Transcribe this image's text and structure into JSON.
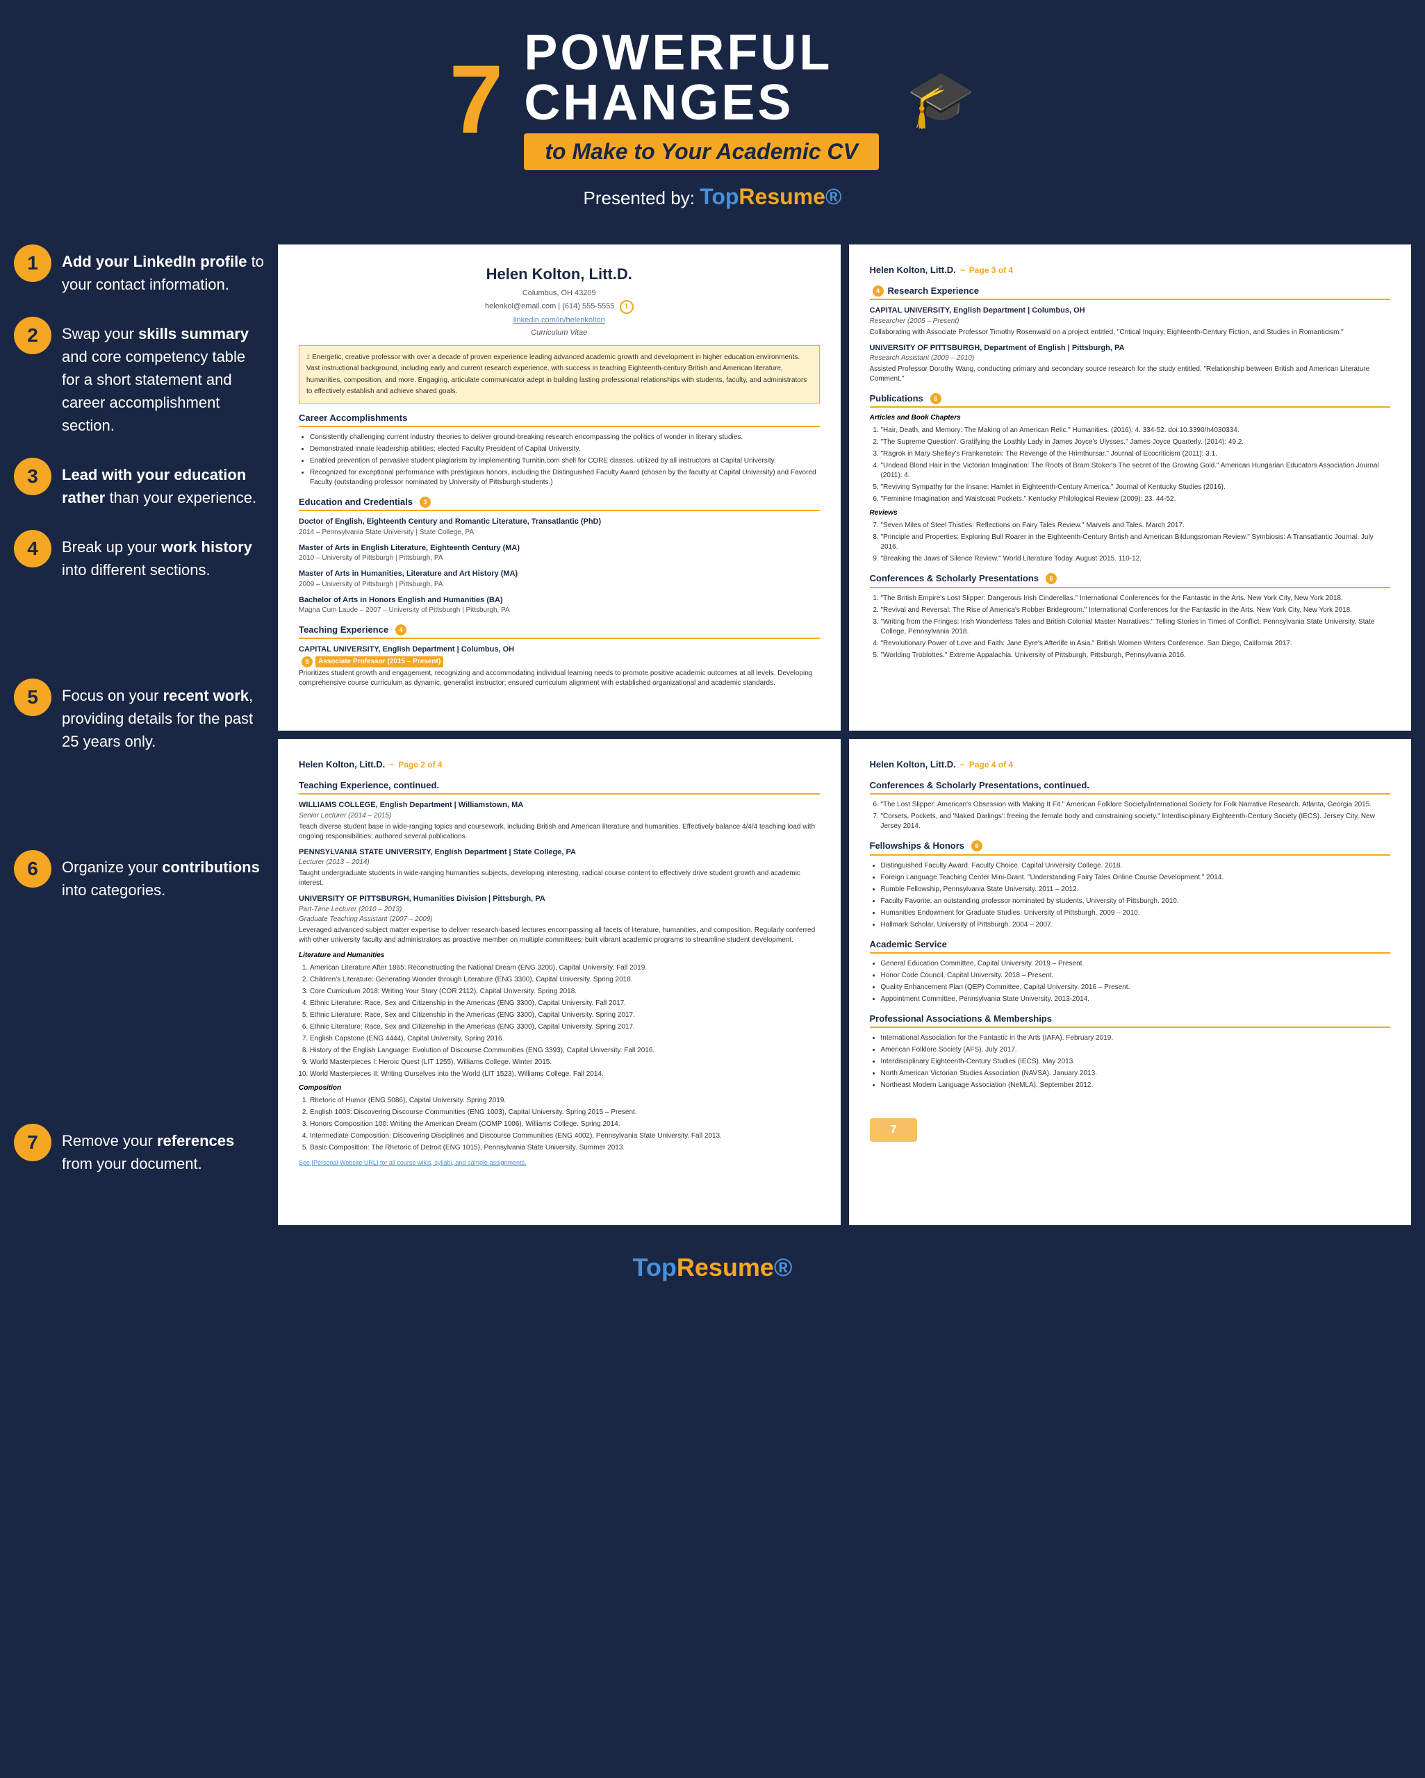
{
  "header": {
    "number": "7",
    "powerful": "POWERFUL",
    "changes": "CHANGES",
    "subtitle": "to Make to Your Academic CV",
    "presented_by": "Presented by:",
    "logo_top": "Top",
    "logo_bottom": "Resume"
  },
  "tips": [
    {
      "number": "1",
      "text_parts": [
        "Add your ",
        "LinkedIn profile",
        " to your contact information."
      ]
    },
    {
      "number": "2",
      "text_parts": [
        "Swap your ",
        "skills summary",
        " and core competency table for a short statement and career accomplishment section."
      ]
    },
    {
      "number": "3",
      "text_parts": [
        "Lead with your ",
        "education rather",
        " than your experience."
      ]
    },
    {
      "number": "4",
      "text_parts": [
        "Break up your ",
        "work history",
        " into different sections."
      ]
    },
    {
      "number": "5",
      "text_parts": [
        "Focus on your ",
        "recent work",
        ", providing details for the past 25 years only."
      ]
    },
    {
      "number": "6",
      "text_parts": [
        "Organize your ",
        "contributions",
        " into categories."
      ]
    },
    {
      "number": "7",
      "text_parts": [
        "Remove your ",
        "references",
        " from your document."
      ]
    }
  ],
  "page1": {
    "name": "Helen Kolton, Litt.D.",
    "location": "Columbus, OH 43209",
    "email": "helenkol@email.com",
    "phone": "(614) 555-5555",
    "linkedin": "linkedin.com/in/helenkolton",
    "vitae": "Curriculum Vitae",
    "summary": "Energetic, creative professor with over a decade of proven experience leading advanced academic growth and development in higher education environments. Vast instructional background, including early and current research experience, with success in teaching Eighteenth-century British and American literature, humanities, composition, and more. Engaging, articulate communicator adept in building lasting professional relationships with students, faculty, and administrators to effectively establish and achieve shared goals.",
    "section_career": "Career Accomplishments",
    "career_items": [
      "Consistently challenging current industry theories to deliver ground-breaking research encompassing the politics of wonder in literary studies.",
      "Demonstrated innate leadership abilities; elected Faculty President of Capital University.",
      "Enabled prevention of pervasive student plagiarism by implementing Turnitin.com shell for CORE classes, utilized by all instructors at Capital University.",
      "Recognized for exceptional performance with prestigious honors, including the Distinguished Faculty Award (chosen by the faculty at Capital University) and Favored Faculty (outstanding professor nominated by University of Pittsburgh students.)"
    ],
    "section_education": "Education and Credentials",
    "education_badge": "3",
    "education_items": [
      {
        "degree": "Doctor of English, Eighteenth Century and Romantic Literature, Transatlantic (PhD)",
        "detail": "2014 – Pennsylvania State University | State College, PA"
      },
      {
        "degree": "Master of Arts in English Literature, Eighteenth Century (MA)",
        "detail": "2010 – University of Pittsburgh | Pittsburgh, PA"
      },
      {
        "degree": "Master of Arts in Humanities, Literature and Art History (MA)",
        "detail": "2009 – University of Pittsburgh | Pittsburgh, PA"
      },
      {
        "degree": "Bachelor of Arts in Honors English and Humanities (BA)",
        "detail": "Magna Cum Laude – 2007 – University of Pittsburgh | Pittsburgh, PA"
      }
    ],
    "section_teaching": "Teaching Experience",
    "teaching_badge": "4",
    "teaching_place": "CAPITAL UNIVERSITY, English Department | Columbus, OH",
    "teaching_role1": "Associate Professor (2015 – Present)",
    "teaching_role1_body": "Prioritizes student growth and engagement, recognizing and accommodating individual learning needs to promote positive academic outcomes at all levels. Developing comprehensive course curriculum as dynamic, generalist instructor; ensured curriculum alignment with established organizational and academic standards."
  },
  "page2": {
    "name": "Helen Kolton, Litt.D.",
    "page": "Page 2 of 4",
    "section_teaching_cont": "Teaching Experience, continued.",
    "williams": {
      "college": "WILLIAMS COLLEGE, English Department | Williamstown, MA",
      "role": "Senior Lecturer (2014 – 2015)",
      "body": "Teach diverse student base in wide-ranging topics and coursework, including British and American literature and humanities. Effectively balance 4/4/4 teaching load with ongoing responsibilities; authored several publications."
    },
    "penn_state": {
      "college": "PENNSYLVANIA STATE UNIVERSITY, English Department | State College, PA",
      "role": "Lecturer (2013 – 2014)",
      "body": "Taught undergraduate students in wide-ranging humanities subjects, developing interesting, radical course content to effectively drive student growth and academic interest."
    },
    "pitt": {
      "college": "UNIVERSITY OF PITTSBURGH, Humanities Division | Pittsburgh, PA",
      "role1": "Part-Time Lecturer (2010 – 2013)",
      "role2": "Graduate Teaching Assistant (2007 – 2009)",
      "body": "Leveraged advanced subject matter expertise to deliver research-based lectures encompassing all facets of literature, humanities, and composition. Regularly conferred with other university faculty and administrators as proactive member on multiple committees; built vibrant academic programs to streamline student development."
    },
    "lit_hum": "Literature and Humanities",
    "lit_hum_courses": [
      "American Literature After 1865: Reconstructing the National Dream (ENG 3200), Capital University. Fall 2019.",
      "Children's Literature: Generating Wonder through Literature (ENG 3300), Capital University. Spring 2018.",
      "Core Curriculum 2018: Writing Your Story (COR 2112), Capital University. Spring 2018.",
      "Ethnic Literature: Race, Sex and Citizenship in the Americas (ENG 3300), Capital University. Fall 2017.",
      "Ethnic Literature: Race, Sex and Citizenship in the Americas (ENG 3300), Capital University. Spring 2017.",
      "Ethnic Literature: Race, Sex and Citizenship in the Americas (ENG 3300), Capital University. Spring 2017.",
      "English Capstone (ENG 4444), Capital University. Spring 2016.",
      "History of the English Language: Evolution of Discourse Communities (ENG 3393), Capital University. Fall 2016.",
      "World Masterpieces I: Heroic Quest (LIT 1255), Williams College. Winter 2015.",
      "World Masterpieces II: Writing Ourselves into the World (LIT 1523), Williams College. Fall 2014."
    ],
    "composition": "Composition",
    "composition_courses": [
      "Rhetoric of Humor (ENG 5086), Capital University. Spring 2019.",
      "English 1003: Discovering Discourse Communities (ENG 1003), Capital University. Spring 2015 – Present.",
      "Honors Composition 100: Writing the American Dream (COMP 1006), Williams College. Spring 2014.",
      "Intermediate Composition: Discovering Disciplines and Discourse Communities (ENG 4002), Pennsylvania State University. Fall 2013.",
      "Basic Composition: The Rhetoric of Detroit (ENG 1015), Pennsylvania State University. Summer 2013."
    ],
    "website_note": "See [Personal Website URL] for all course wikis, syllabi, and sample assignments."
  },
  "page3": {
    "name": "Helen Kolton, Litt.D.",
    "page": "Page 3 of 4",
    "section_research": "Research Experience",
    "research_badge": "4",
    "research_items": [
      {
        "place": "CAPITAL UNIVERSITY, English Department | Columbus, OH",
        "role": "Researcher (2005 – Present)",
        "body": "Collaborating with Associate Professor Timothy Rosenwald on a project entitled, \"Critical Inquiry, Eighteenth-Century Fiction, and Studies in Romanticism.\""
      },
      {
        "place": "UNIVERSITY OF PITTSBURGH, Department of English | Pittsburgh, PA",
        "role": "Research Assistant (2009 – 2010)",
        "body": "Assisted Professor Dorothy Wang, conducting primary and secondary source research for the study entitled, \"Relationship between British and American Literature Comment.\""
      }
    ],
    "section_publications": "Publications",
    "publications_badge": "6",
    "articles_header": "Articles and Book Chapters",
    "articles": [
      "\"Hair, Death, and Memory: The Making of an American Relic.\" Humanities. (2016): 4. 334-52. doi:10.3390/h4030334.",
      "\"The Supreme Question': Gratifying the Loathly Lady in James Joyce's Ulysses.\" James Joyce Quarterly. (2014): 49.2.",
      "\"Ragrok in Mary Shelley's Frankenstein: The Revenge of the Hrimthursar.\" Journal of Ecocriticism (2011): 3.1.",
      "\"Undead Blond Hair in the Victorian Imagination: The Roots of Bram Stoker's The secret of the Growing Gold.\" American Hungarian Educators Association Journal (2011): 4.",
      "\"Reviving Sympathy for the Insane: Hamlet in Eighteenth-Century America.\" Journal of Kentucky Studies (2016).",
      "\"Feminine Imagination and Waistcoat Pockets.\" Kentucky Philological Review (2009): 23. 44-52."
    ],
    "reviews_header": "Reviews",
    "reviews": [
      "\"Seven Miles of Steel Thistles: Reflections on Fairy Tales Review.\" Marvels and Tales. March 2017.",
      "\"Principle and Properties: Exploring Bull Roarer in the Eighteenth-Century British and American Bildungsroman Review.\" Symbiosis: A Transatlantic Journal. July 2016.",
      "\"Breaking the Jaws of Silence Review.\" World Literature Today. August 2015. 110-12."
    ],
    "section_conferences": "Conferences & Scholarly Presentations",
    "conferences_badge": "6",
    "conferences": [
      "\"The British Empire's Lost Slipper: Dangerous Irish Cinderellas.\" International Conferences for the Fantastic in the Arts. New York City, New York 2018.",
      "\"Revival and Reversal: The Rise of America's Robber Bridegroom.\" International Conferences for the Fantastic in the Arts. New York City, New York 2018.",
      "\"Writing from the Fringes: Irish Wonderless Tales and British Colonial Master Narratives.\" Telling Stories in Times of Conflict. Pennsylvania State University, State College, Pennsylvania 2018.",
      "\"Revolutionary Power of Love and Faith: Jane Eyre's Afterlife in Asia.\" British Women Writers Conference. San Diego, California 2017.",
      "\"Worlding Troblottes.\" Extreme Appalachia. University of Pittsburgh, Pittsburgh, Pennsylvania 2016."
    ]
  },
  "page4": {
    "name": "Helen Kolton, Litt.D.",
    "page": "Page 4 of 4",
    "section_conferences_cont": "Conferences & Scholarly Presentations, continued.",
    "conferences_cont": [
      "\"The Lost Slipper: American's Obsession with Making It Fit.\" American Folklore Society/International Society for Folk Narrative Research. Atlanta, Georgia 2015.",
      "\"Corsets, Pockets, and 'Naked Darlings': freeing the female body and constraining society.\" Interdisciplinary Eighteenth-Century Society (IECS). Jersey City, New Jersey 2014."
    ],
    "section_fellowships": "Fellowships & Honors",
    "fellowships_badge": "6",
    "fellowships": [
      "Distinguished Faculty Award. Faculty Choice. Capital University College. 2018.",
      "Foreign Language Teaching Center Mini-Grant. \"Understanding Fairy Tales Online Course Development.\" 2014.",
      "Rumble Fellowship, Pennsylvania State University. 2011 – 2012.",
      "Faculty Favorite: an outstanding professor nominated by students, University of Pittsburgh. 2010.",
      "Humanities Endowment for Graduate Studies, University of Pittsburgh. 2009 – 2010.",
      "Hallmark Scholar, University of Pittsburgh. 2004 – 2007."
    ],
    "section_academic": "Academic Service",
    "academic_items": [
      "General Education Committee, Capital University. 2019 – Present.",
      "Honor Code Council, Capital University. 2018 – Present.",
      "Quality Enhancement Plan (QEP) Committee, Capital University. 2016 – Present.",
      "Appointment Committee, Pennsylvania State University. 2013-2014."
    ],
    "section_professional": "Professional Associations & Memberships",
    "professional_items": [
      "International Association for the Fantastic in the Arts (IAFA). February 2019.",
      "American Folklore Society (AFS). July 2017.",
      "Interdisciplinary Eighteenth-Century Studies (IECS). May 2013.",
      "North American Victorian Studies Association (NAVSA). January 2013.",
      "Northeast Modern Language Association (NeMLA). September 2012."
    ],
    "references_note": "7"
  },
  "footer": {
    "logo": "TopResume"
  }
}
